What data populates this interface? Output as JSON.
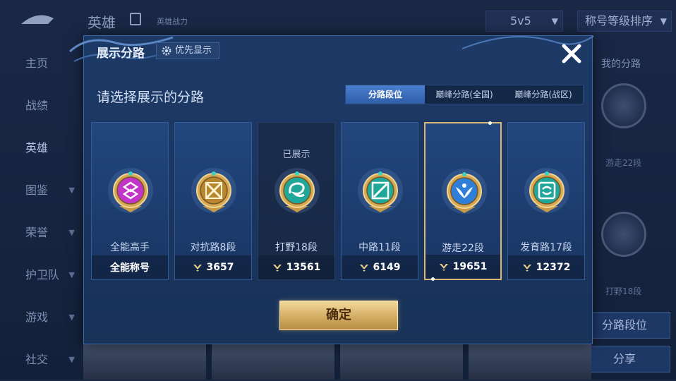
{
  "background": {
    "top_title": "英雄",
    "top_subtitle": "英雄战力",
    "mode_select": "5v5",
    "sort_select": "称号等级排序",
    "nav": [
      {
        "label": "主页",
        "arrow": false,
        "active": false
      },
      {
        "label": "战绩",
        "arrow": false,
        "active": false
      },
      {
        "label": "英雄",
        "arrow": false,
        "active": true
      },
      {
        "label": "图鉴",
        "arrow": true,
        "active": false
      },
      {
        "label": "荣誉",
        "arrow": true,
        "active": false
      },
      {
        "label": "护卫队",
        "arrow": true,
        "active": false
      },
      {
        "label": "游戏",
        "arrow": true,
        "active": false
      },
      {
        "label": "社交",
        "arrow": true,
        "active": false
      }
    ],
    "right_panel": {
      "label": "我的分路",
      "medal1_sub": "游走22段",
      "medal2_sub": "打野18段",
      "lane_rank_button": "分路段位",
      "share_button": "分享"
    }
  },
  "modal": {
    "title": "展示分路",
    "priority_button": "优先显示",
    "prompt": "请选择展示的分路",
    "tabs": [
      {
        "label": "分路段位",
        "active": true
      },
      {
        "label": "巅峰分路(全国)",
        "active": false
      },
      {
        "label": "巅峰分路(战区)",
        "active": false
      }
    ],
    "cards": [
      {
        "name": "全能高手",
        "footer": "全能称号",
        "points": null,
        "shown_label": "",
        "medal_color": "#c335c9",
        "icon": "all-round-icon",
        "selected": false,
        "dark": false
      },
      {
        "name": "对抗路8段",
        "footer": "3657",
        "points": true,
        "shown_label": "",
        "medal_color": "#b8862e",
        "icon": "clash-lane-icon",
        "selected": false,
        "dark": false
      },
      {
        "name": "打野18段",
        "footer": "13561",
        "points": true,
        "shown_label": "已展示",
        "medal_color": "#1fa79a",
        "icon": "jungle-dragon-icon",
        "selected": false,
        "dark": true
      },
      {
        "name": "中路11段",
        "footer": "6149",
        "points": true,
        "shown_label": "",
        "medal_color": "#1fa79a",
        "icon": "mid-lane-icon",
        "selected": false,
        "dark": false
      },
      {
        "name": "游走22段",
        "footer": "19651",
        "points": true,
        "shown_label": "",
        "medal_color": "#2f7fd8",
        "icon": "roam-wings-icon",
        "selected": true,
        "dark": false
      },
      {
        "name": "发育路17段",
        "footer": "12372",
        "points": true,
        "shown_label": "",
        "medal_color": "#1fa79a",
        "icon": "farm-lane-icon",
        "selected": false,
        "dark": false
      }
    ],
    "confirm_button": "确定"
  }
}
